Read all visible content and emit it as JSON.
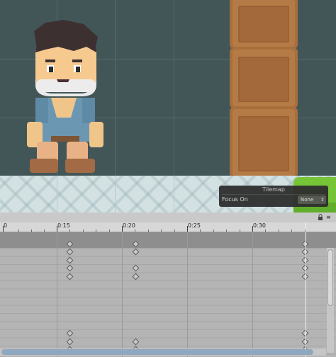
{
  "scene": {
    "panel_title": "Tilemap",
    "focus_label": "Focus On",
    "focus_value": "None",
    "select_arrows_icon": "up-down-arrows-icon"
  },
  "timeline": {
    "start_label": "0",
    "labels": [
      "0:15",
      "0:20",
      "0:25",
      "0:30"
    ],
    "lock_icon": "lock-icon",
    "menu_icon": "menu-icon"
  },
  "colors": {
    "scene_bg": "#435657",
    "crate": "#b57b46",
    "ground": "#d3e1e3",
    "grass": "#76c537",
    "timeline_bg": "#adadad",
    "scroll_thumb": "#8fa7bf"
  }
}
